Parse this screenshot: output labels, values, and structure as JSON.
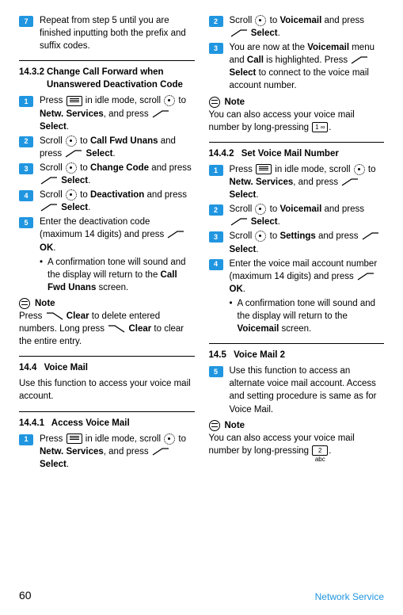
{
  "col1": {
    "step7": {
      "num": "7",
      "text_a": "Repeat from step 5 until you are finished inputting both the prefix and suffix codes."
    },
    "h1432": {
      "num": "14.3.2",
      "title": "Change Call Forward when Unanswered Deactivation Code"
    },
    "s1": {
      "num": "1",
      "a": "Press ",
      "b": " in idle mode, scroll ",
      "c": " to ",
      "d": "Netw. Services",
      "e": ", and press ",
      "f": "Select",
      "g": "."
    },
    "s2": {
      "num": "2",
      "a": "Scroll ",
      "b": " to ",
      "c": "Call Fwd Unans",
      "d": " and press ",
      "e": " ",
      "f": "Select",
      "g": "."
    },
    "s3": {
      "num": "3",
      "a": "Scroll ",
      "b": " to ",
      "c": "Change Code",
      "d": " and press ",
      "e": " ",
      "f": "Select",
      "g": "."
    },
    "s4": {
      "num": "4",
      "a": "Scroll ",
      "b": " to ",
      "c": "Deactivation",
      "d": " and press ",
      "e": " ",
      "f": "Select",
      "g": "."
    },
    "s5": {
      "num": "5",
      "a": "Enter the deactivation code (maximum 14 digits) and press ",
      "b": "OK",
      "c": "."
    },
    "bullet1": {
      "a": "A confirmation tone will sound and the display will return to the ",
      "b": "Call Fwd Unans",
      "c": " screen."
    },
    "noteLabel": "Note",
    "noteText": {
      "a": "Press ",
      "b": " ",
      "c": "Clear",
      "d": " to delete entered numbers. Long press ",
      "e": " ",
      "f": "Clear",
      "g": " to clear the entire entry."
    },
    "h144": {
      "num": "14.4",
      "title": "Voice Mail"
    },
    "p144": "Use this function to access your voice mail account.",
    "h1441": {
      "num": "14.4.1",
      "title": "Access Voice Mail"
    },
    "avm1": {
      "num": "1",
      "a": "Press ",
      "b": " in idle mode, scroll ",
      "c": " to ",
      "d": "Netw. Services",
      "e": ", and press ",
      "f": "Select",
      "g": "."
    }
  },
  "col2": {
    "avm2": {
      "num": "2",
      "a": "Scroll ",
      "b": " to ",
      "c": "Voicemail",
      "d": " and press ",
      "e": " ",
      "f": "Select",
      "g": "."
    },
    "avm3": {
      "num": "3",
      "a": "You are now at the ",
      "b": "Voicemail",
      "c": " menu and ",
      "d": "Call",
      "e": " is highlighted. Press ",
      "f": " ",
      "g": "Select",
      "h": " to connect to the voice mail account number."
    },
    "noteLabel": "Note",
    "noteText": {
      "a": "You can also access your voice mail number by long-pressing ",
      "b": "."
    },
    "h1442": {
      "num": "14.4.2",
      "title": "Set Voice Mail Number"
    },
    "sv1": {
      "num": "1",
      "a": "Press ",
      "b": " in idle mode, scroll ",
      "c": " to ",
      "d": "Netw. Services",
      "e": ", and press ",
      "f": "Select",
      "g": "."
    },
    "sv2": {
      "num": "2",
      "a": "Scroll ",
      "b": " to ",
      "c": "Voicemail",
      "d": " and press ",
      "e": " ",
      "f": "Select",
      "g": "."
    },
    "sv3": {
      "num": "3",
      "a": "Scroll ",
      "b": " to ",
      "c": "Settings",
      "d": " and press ",
      "e": " ",
      "f": "Select",
      "g": "."
    },
    "sv4": {
      "num": "4",
      "a": "Enter the voice mail account number (maximum 14 digits) and press ",
      "b": " ",
      "c": "OK",
      "d": "."
    },
    "bullet2": {
      "a": "A confirmation tone will sound and the display will return to the ",
      "b": "Voicemail",
      "c": " screen."
    },
    "h145": {
      "num": "14.5",
      "title": "Voice Mail 2"
    },
    "vm2": {
      "num": "5",
      "a": "Use this function to access an alternate voice mail account. Access and setting procedure is same as for Voice Mail."
    },
    "noteLabel2": "Note",
    "noteText2": {
      "a": "You can also access your voice mail number by long-pressing ",
      "b": "."
    }
  },
  "keys": {
    "key1": "1 ∞",
    "key2": "2 abc"
  },
  "footer": {
    "page": "60",
    "section": "Network Service"
  }
}
